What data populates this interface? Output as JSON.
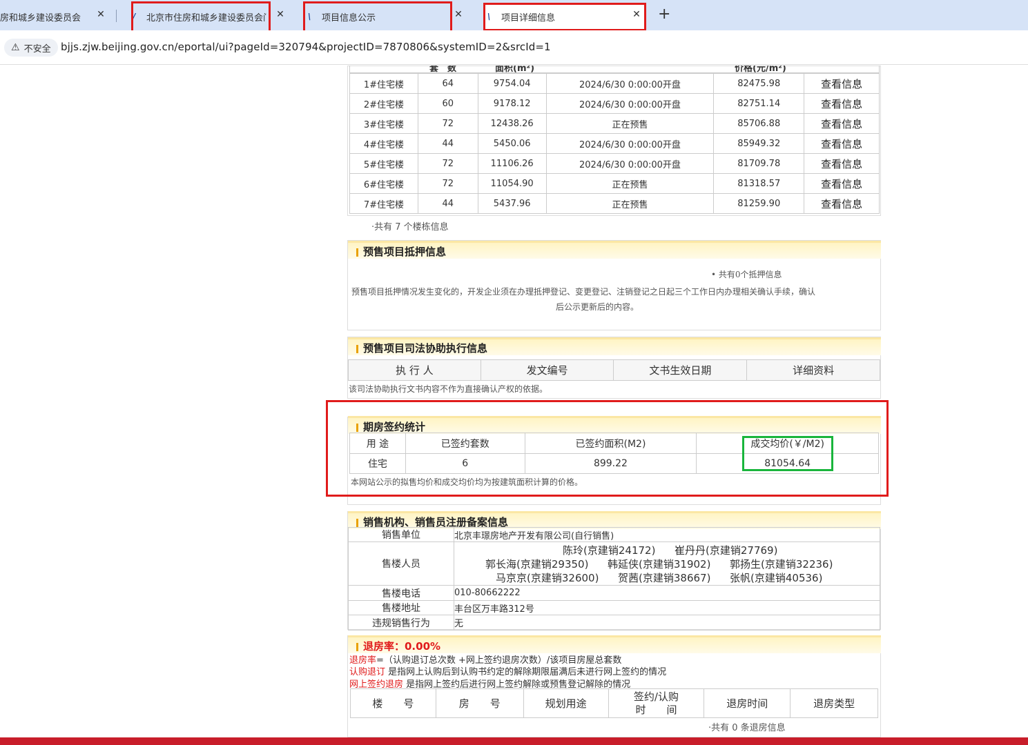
{
  "browser": {
    "tabs": [
      {
        "label": "房和城乡建设委员会",
        "active": false
      },
      {
        "label": "北京市住房和城乡建设委员会门",
        "active": false
      },
      {
        "label": "项目信息公示",
        "active": false
      },
      {
        "label": "项目详细信息",
        "active": true
      }
    ],
    "close_glyph": "✕",
    "new_tab_glyph": "+",
    "security_label": "不安全",
    "url": "bjjs.zjw.beijing.gov.cn/eportal/ui?pageId=320794&projectID=7870806&systemID=2&srcId=1"
  },
  "buildings": {
    "header": [
      "套　数",
      "面积(m²)",
      "价格(元/m²)"
    ],
    "rows": [
      {
        "name": "1#住宅楼",
        "units": "64",
        "area": "9754.04",
        "status": "2024/6/30 0:00:00开盘",
        "price": "82475.98",
        "link": "查看信息"
      },
      {
        "name": "2#住宅楼",
        "units": "60",
        "area": "9178.12",
        "status": "2024/6/30 0:00:00开盘",
        "price": "82751.14",
        "link": "查看信息"
      },
      {
        "name": "3#住宅楼",
        "units": "72",
        "area": "12438.26",
        "status": "正在预售",
        "price": "85706.88",
        "link": "查看信息"
      },
      {
        "name": "4#住宅楼",
        "units": "44",
        "area": "5450.06",
        "status": "2024/6/30 0:00:00开盘",
        "price": "85949.32",
        "link": "查看信息"
      },
      {
        "name": "5#住宅楼",
        "units": "72",
        "area": "11106.26",
        "status": "2024/6/30 0:00:00开盘",
        "price": "81709.78",
        "link": "查看信息"
      },
      {
        "name": "6#住宅楼",
        "units": "72",
        "area": "11054.90",
        "status": "正在预售",
        "price": "81318.57",
        "link": "查看信息"
      },
      {
        "name": "7#住宅楼",
        "units": "44",
        "area": "5437.96",
        "status": "正在预售",
        "price": "81259.90",
        "link": "查看信息"
      }
    ],
    "total_text": "·共有 7 个楼栋信息"
  },
  "mortgage": {
    "title": "预售项目抵押信息",
    "count_text": "• 共有0个抵押信息",
    "note_line1": "预售项目抵押情况发生变化的，开发企业须在办理抵押登记、变更登记、注销登记之日起三个工作日内办理相关确认手续，确认",
    "note_line2": "后公示更新后的内容。"
  },
  "judicial": {
    "title": "预售项目司法协助执行信息",
    "columns": [
      "执 行 人",
      "发文编号",
      "文书生效日期",
      "详细资料"
    ],
    "note": "该司法协助执行文书内容不作为直接确认产权的依据。"
  },
  "signing": {
    "title": "期房签约统计",
    "columns": [
      "用 途",
      "已签约套数",
      "已签约面积(M2)",
      "成交均价(￥/M2)"
    ],
    "row": [
      "住宅",
      "6",
      "899.22",
      "81054.64"
    ],
    "note": "本网站公示的拟售均价和成交均价均为按建筑面积计算的价格。"
  },
  "sales": {
    "title": "销售机构、销售员注册备案信息",
    "unit_label": "销售单位",
    "unit_value": "北京丰璟房地产开发有限公司(自行销售)",
    "staff_label": "售楼人员",
    "staff_line1": [
      "陈玲(京建销24172)",
      "崔丹丹(京建销27769)"
    ],
    "staff_line2": [
      "郭长海(京建销29350)",
      "韩延侠(京建销31902)",
      "郭扬生(京建销32236)"
    ],
    "staff_line3": [
      "马京京(京建销32600)",
      "贺茜(京建销38667)",
      "张帆(京建销40536)"
    ],
    "phone_label": "售楼电话",
    "phone_value": "010-80662222",
    "address_label": "售楼地址",
    "address_value": "丰台区万丰路312号",
    "violation_label": "违规销售行为",
    "violation_value": "无"
  },
  "refund": {
    "title": "退房率：0.00%",
    "line1_key": "退房率",
    "line1_rest": "=（认购退订总次数 +网上签约退房次数）/该项目房屋总套数",
    "line2_key": "认购退订",
    "line2_rest": " 是指网上认购后到认购书约定的解除期限届满后未进行网上签约的情况",
    "line3_key": "网上签约退房",
    "line3_rest": " 是指网上签约后进行网上签约解除或预售登记解除的情况",
    "columns": [
      "楼　　号",
      "房　　号",
      "规划用途",
      "签约/认购",
      "时　　间",
      "退房时间",
      "退房类型"
    ],
    "total_text": "·共有 0 条退房信息"
  },
  "colors": {
    "highlight_red": "#e01b1b",
    "highlight_green": "#19b53c",
    "accent_red": "#c81d2a"
  }
}
